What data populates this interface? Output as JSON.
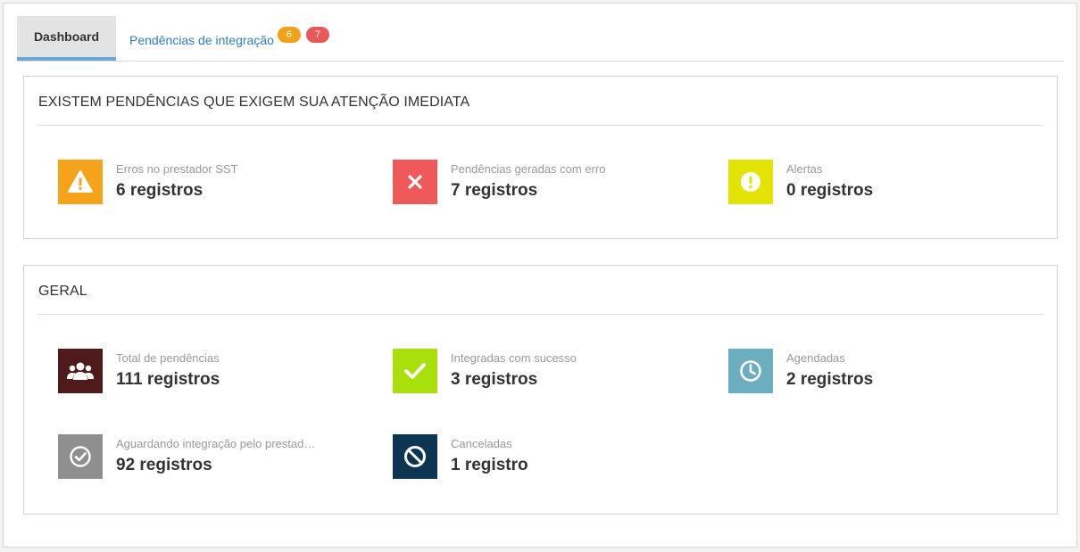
{
  "tabs": {
    "dashboard": "Dashboard",
    "pendencias": "Pendências de integração",
    "badge_warning": "6",
    "badge_error": "7"
  },
  "urgent": {
    "title": "EXISTEM PENDÊNCIAS QUE EXIGEM SUA ATENÇÃO IMEDIATA",
    "items": [
      {
        "label": "Erros no prestador SST",
        "value": "6 registros",
        "icon": "warning-triangle-icon",
        "color": "#f5a31a"
      },
      {
        "label": "Pendências geradas com erro",
        "value": "7 registros",
        "icon": "close-icon",
        "color": "#ee5a5a"
      },
      {
        "label": "Alertas",
        "value": "0 registros",
        "icon": "exclamation-circle-icon",
        "color": "#e3e305"
      }
    ]
  },
  "general": {
    "title": "GERAL",
    "items": [
      {
        "label": "Total de pendências",
        "value": "111 registros",
        "icon": "users-icon",
        "color": "#4e1a1a"
      },
      {
        "label": "Integradas com sucesso",
        "value": "3 registros",
        "icon": "checkmark-icon",
        "color": "#a9e00a"
      },
      {
        "label": "Agendadas",
        "value": "2 registros",
        "icon": "clock-icon",
        "color": "#6aaec0"
      },
      {
        "label": "Aguardando integração pelo prestad…",
        "value": "92 registros",
        "icon": "check-circle-icon",
        "color": "#8f8f8f"
      },
      {
        "label": "Canceladas",
        "value": "1 registro",
        "icon": "ban-icon",
        "color": "#0b3550"
      }
    ]
  }
}
